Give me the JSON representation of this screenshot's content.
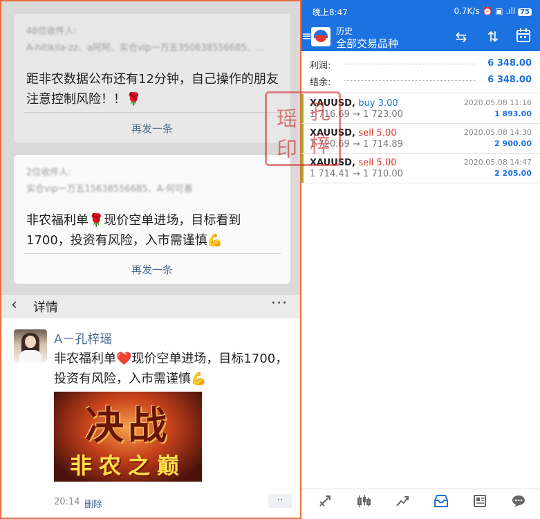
{
  "left": {
    "card1": {
      "sender_line": "48位收件人:",
      "recipients_line": "A-hitikila-zz、a阿阿、实仓vip一万五350638556685、...",
      "message": "距非农数据公布还有12分钟，自己操作的朋友注意控制风险！！🌹",
      "resend": "再发一条"
    },
    "card2": {
      "sender_line": "2位收件人:",
      "recipients_line": "实仓vip一万五15638556685、A-何可善",
      "message": "非农福利单🌹现价空单进场，目标看到1700，投资有风险，入市需谨慎💪",
      "resend": "再发一条"
    },
    "detail": {
      "back_icon": "chevron-left-icon",
      "title": "详情",
      "more": "···",
      "author": "A－孔梓瑶",
      "post_text": "非农福利单❤️现价空单进场，目标1700，投资有风险，入市需谨慎💪",
      "image_big_text": "决战",
      "image_small_text": "非农之巅",
      "time": "20:14",
      "delete": "删除",
      "more_button": "··"
    }
  },
  "right": {
    "status": {
      "time": "晚上8:47",
      "network": "0.7K/s ⏰ ▣ .ıll ",
      "battery": "75"
    },
    "appbar": {
      "menu_icon": "menu-icon",
      "title_small": "历史",
      "title_main": "全部交易品种",
      "icons": [
        "exchange-icon",
        "sort-icon",
        "calendar-icon"
      ]
    },
    "summary": {
      "profit_label": "利润:",
      "profit_value": "6 348.00",
      "balance_label": "结余:",
      "balance_value": "6 348.00"
    },
    "trades": [
      {
        "symbol": "XAUUSD,",
        "side": "buy 3.00",
        "side_color": "#1c72e0",
        "prices": "1 716.69 → 1 723.00",
        "date": "2020.05.08 11:16",
        "profit": "1 893.00"
      },
      {
        "symbol": "XAUUSD,",
        "side": "sell 5.00",
        "side_color": "#e0342a",
        "prices": "1 720.69 → 1 714.89",
        "date": "2020.05.08 14:30",
        "profit": "2 900.00"
      },
      {
        "symbol": "XAUUSD,",
        "side": "sell 5.00",
        "side_color": "#e0342a",
        "prices": "1 714.41 → 1 710.00",
        "date": "2020.05.08 14:47",
        "profit": "2 205.00"
      }
    ],
    "stamp": {
      "chars": [
        "孔",
        "瑶",
        "梓",
        "印"
      ]
    },
    "bottom_nav": [
      "quotes-icon",
      "chart-icon",
      "trade-icon",
      "history-icon",
      "news-icon",
      "chat-icon"
    ]
  },
  "colors": {
    "accent": "#1c72e0",
    "frame": "#ee6d3b",
    "buy": "#1c72e0",
    "sell": "#e0342a",
    "link": "#4c6c94"
  }
}
